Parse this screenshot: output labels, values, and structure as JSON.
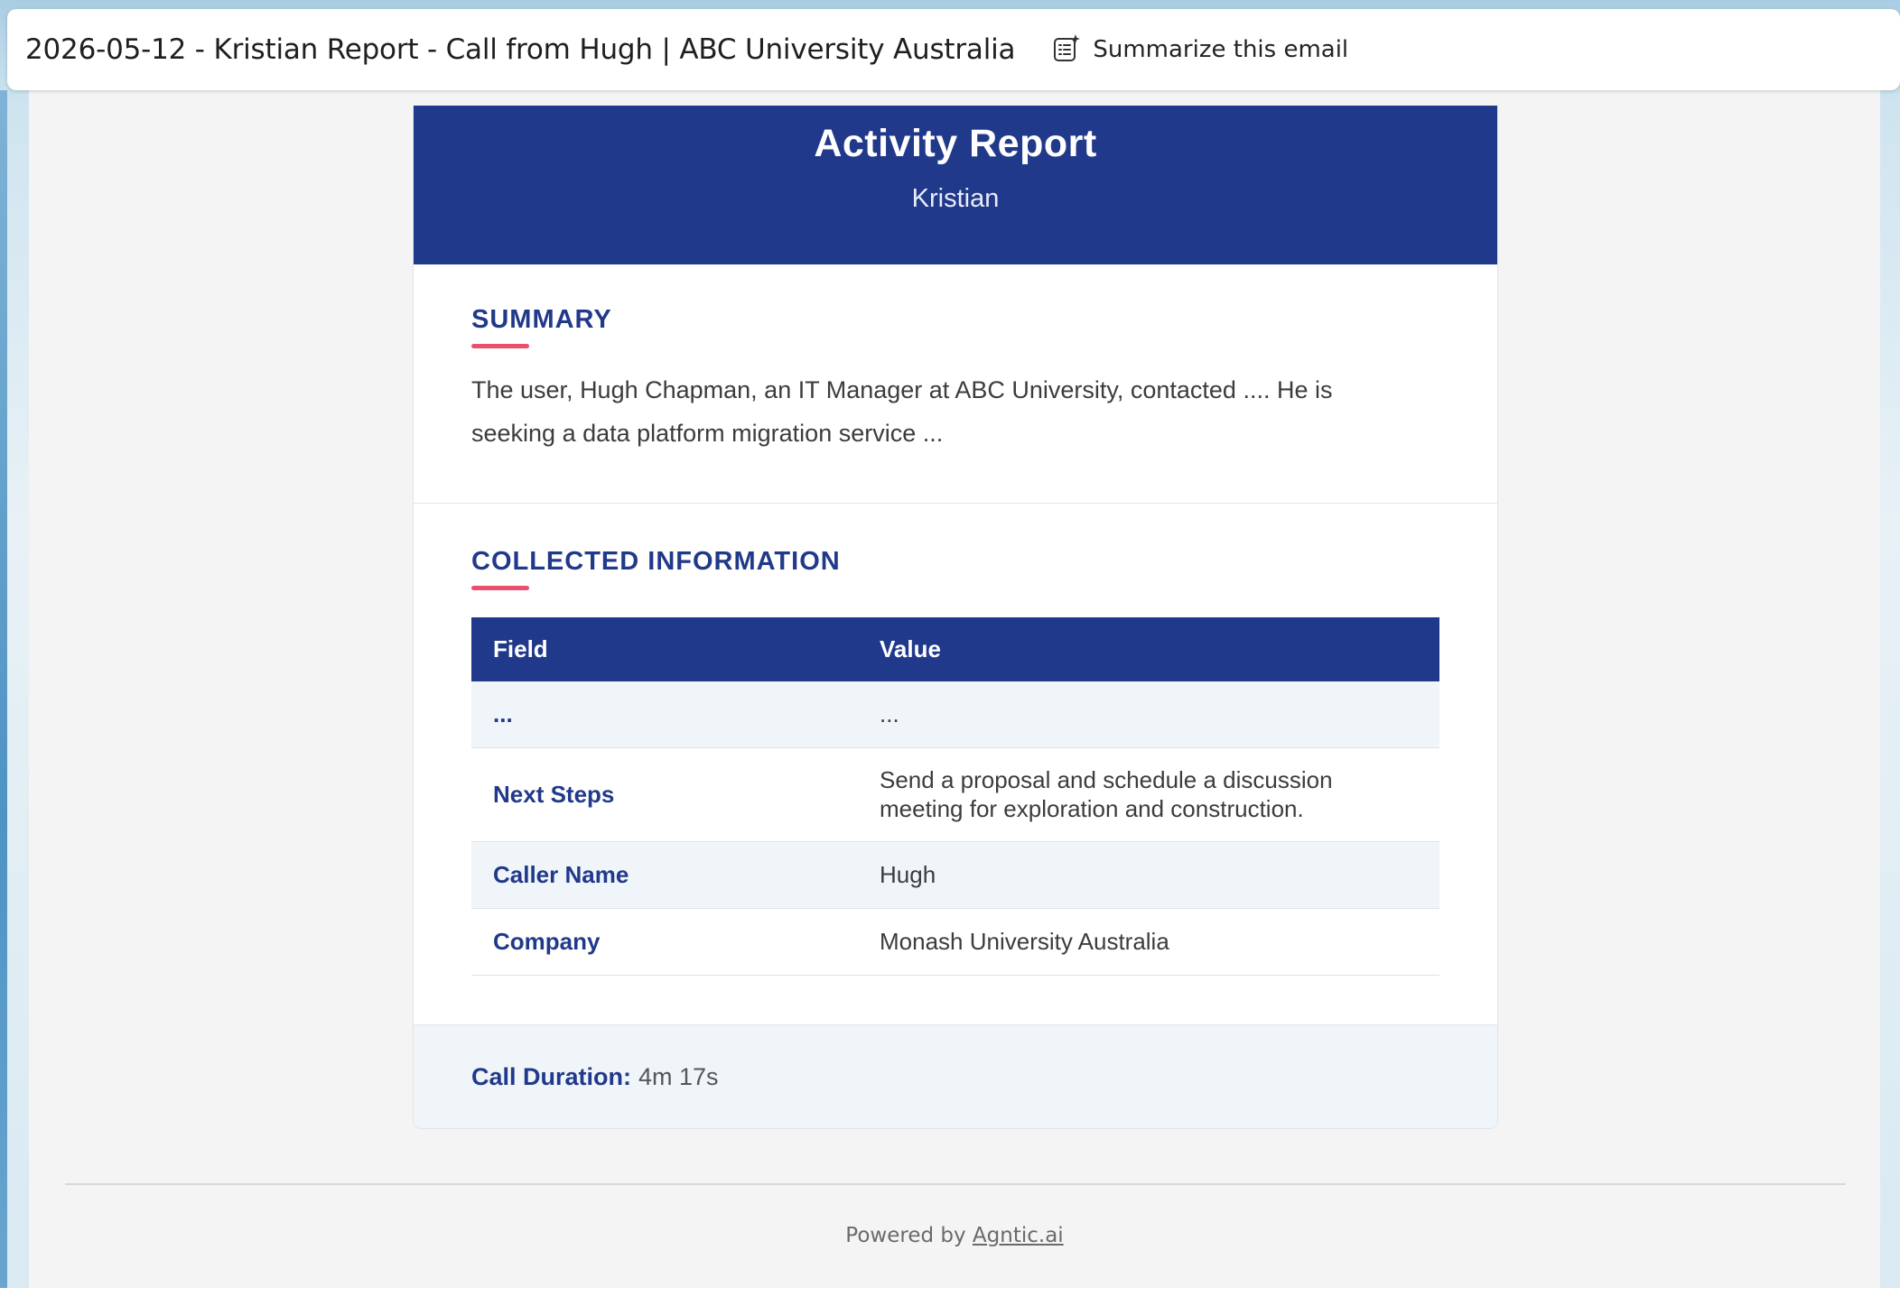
{
  "subject": {
    "title": "2026-05-12 - Kristian Report - Call from Hugh | ABC University Australia",
    "summarize_label": "Summarize this email"
  },
  "report": {
    "title": "Activity Report",
    "subtitle": "Kristian",
    "summary": {
      "heading": "SUMMARY",
      "text": "The user, Hugh Chapman, an IT Manager at ABC University, contacted .... He is seeking a data platform migration service ..."
    },
    "collected": {
      "heading": "COLLECTED INFORMATION",
      "columns": [
        "Field",
        "Value"
      ],
      "rows": [
        {
          "field": "...",
          "value": "..."
        },
        {
          "field": "Next Steps",
          "value": "Send a proposal and schedule a discussion meeting for exploration and construction."
        },
        {
          "field": "Caller Name",
          "value": "Hugh"
        },
        {
          "field": "Company",
          "value": "Monash University Australia"
        }
      ]
    },
    "footer": {
      "duration_label": "Call Duration:",
      "duration_value": "4m 17s"
    }
  },
  "page_footer": {
    "powered_prefix": "Powered by",
    "powered_link": "Agntic.ai"
  },
  "colors": {
    "brand": "#21398a",
    "accent": "#e8506e",
    "row_shade": "#f0f5fa"
  },
  "icons": {
    "summarize": "summarize-sparkle-icon"
  }
}
